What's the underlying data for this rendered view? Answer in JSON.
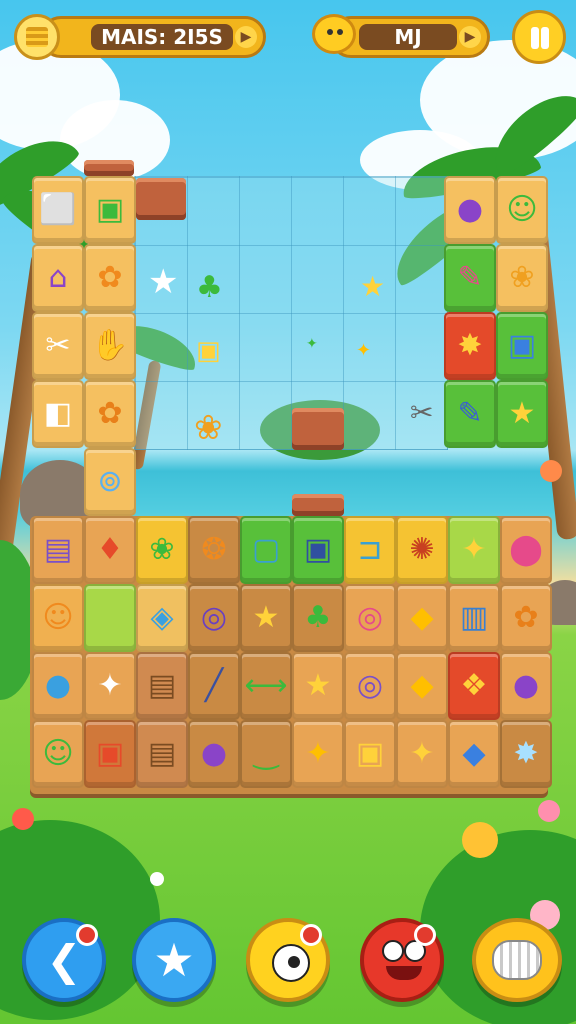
{
  "hud": {
    "score_text": "MAIS: 2I5S",
    "level_text": "MJ"
  },
  "icons": {
    "coin": "coin-stack-icon",
    "creature": "yellow-creature-icon",
    "pause": "pause-icon",
    "back": "back-arrow-icon",
    "star": "star-icon",
    "hint": "eye-creature-icon",
    "shuffle": "red-face-icon",
    "bomb": "striped-ball-icon"
  },
  "tiles": [
    {
      "g": "⬜",
      "c": "#f5c060",
      "sym": "#fff"
    },
    {
      "g": "▣",
      "c": "#f5c060",
      "sym": "#3cba3c"
    },
    {
      "g": "⌂",
      "c": "#f5c060",
      "sym": "#8a44c8"
    },
    {
      "g": "✿",
      "c": "#f5c060",
      "sym": "#f08a1e"
    },
    {
      "g": "★",
      "c": "#f5c060",
      "sym": "#fff"
    },
    {
      "g": "♣",
      "c": "#f5c060",
      "sym": "#3cba3c"
    },
    {
      "g": "◆",
      "c": "#ffd23a",
      "sym": "#e88a1a"
    },
    {
      "g": "✦",
      "c": "#ffd23a",
      "sym": "#ffbf00"
    },
    {
      "g": "●",
      "c": "#f5c060",
      "sym": "#5ab0f0"
    },
    {
      "g": "▲",
      "c": "#d88548",
      "sym": "#e65a1a"
    }
  ],
  "colors": {
    "accent": "#f2b51c",
    "hud_panel": "#7a4b21",
    "tile_orange": "#e8a454",
    "tile_yellow": "#f5c332",
    "tile_green": "#58c03a",
    "tile_red": "#e44a2a",
    "tile_brown": "#c98a44"
  }
}
